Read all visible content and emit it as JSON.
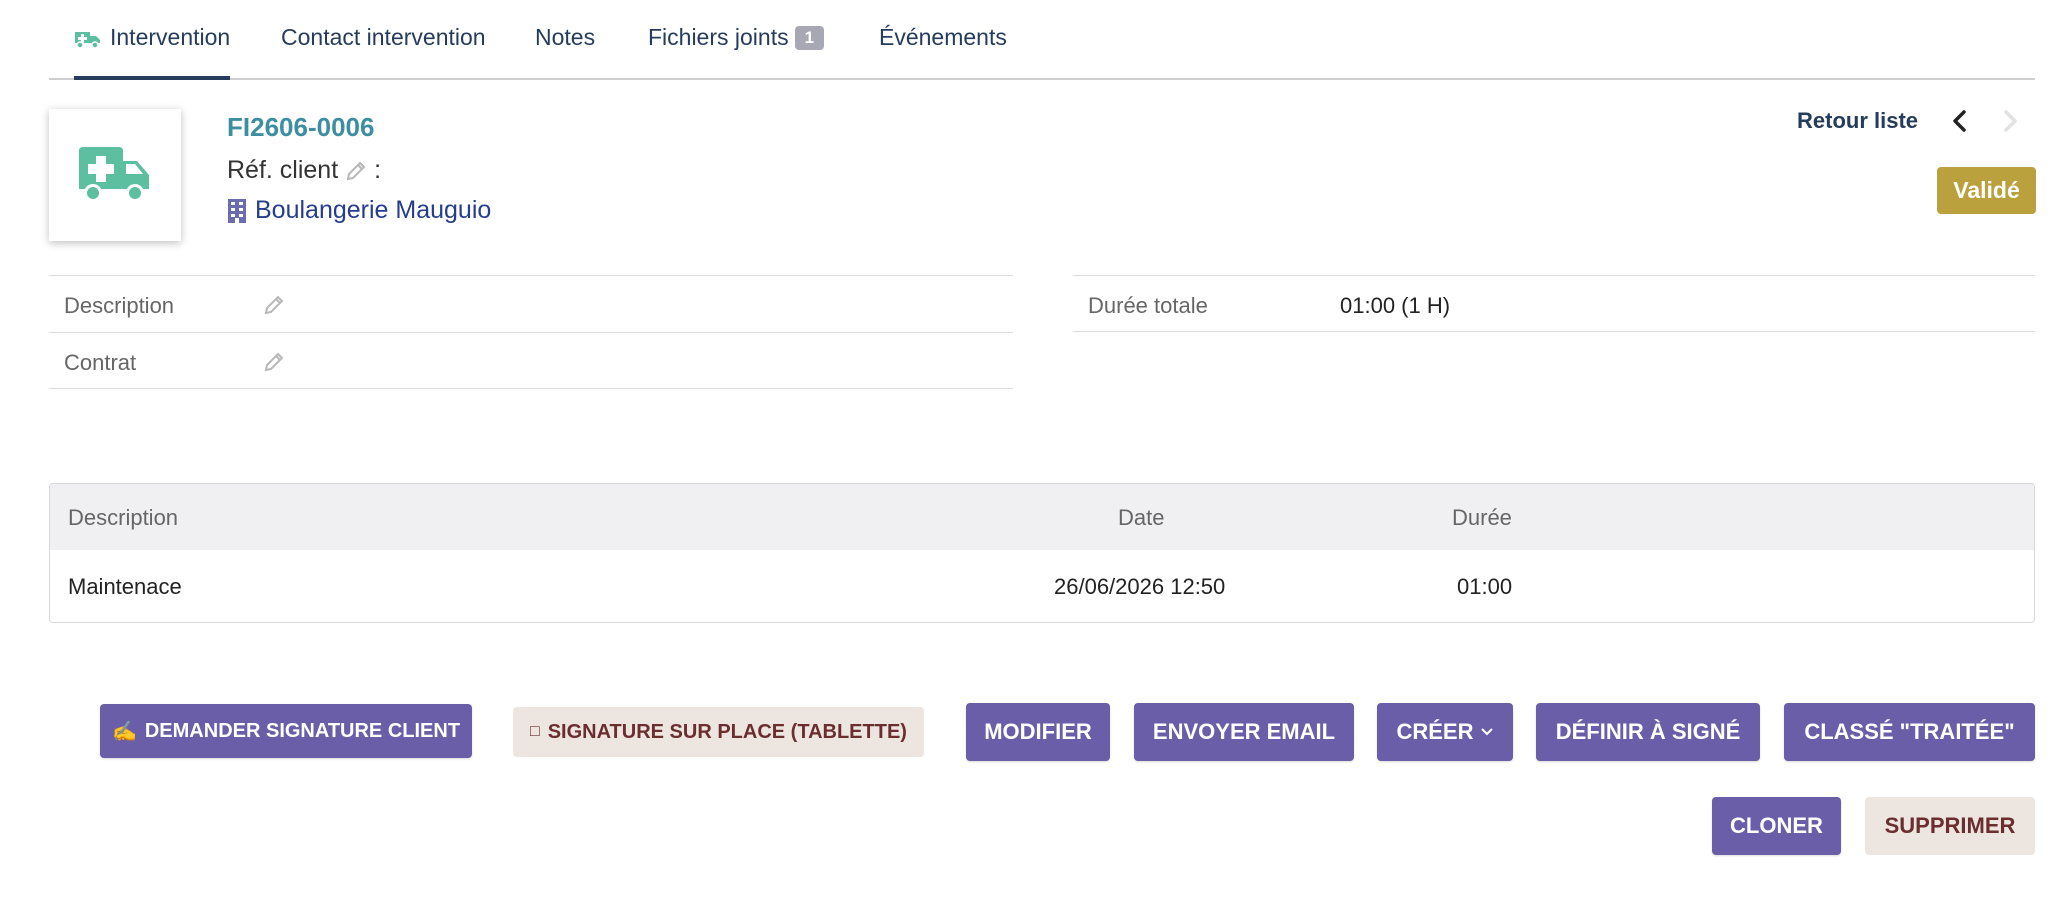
{
  "tabs": [
    {
      "label": "Intervention",
      "icon": "ambulance-icon",
      "active": true
    },
    {
      "label": "Contact intervention"
    },
    {
      "label": "Notes"
    },
    {
      "label": "Fichiers joints",
      "badge": "1"
    },
    {
      "label": "Événements"
    }
  ],
  "header": {
    "ref": "FI2606-0006",
    "ref_client_label": "Réf. client",
    "ref_client_suffix": ":",
    "company": "Boulangerie Mauguio",
    "back_label": "Retour liste",
    "status": "Validé",
    "logo_icon": "ambulance-icon"
  },
  "fields_left": [
    {
      "label": "Description",
      "value": ""
    },
    {
      "label": "Contrat",
      "value": ""
    }
  ],
  "fields_right": [
    {
      "label": "Durée totale",
      "value": "01:00 (1 H)"
    }
  ],
  "lines": {
    "headers": {
      "description": "Description",
      "date": "Date",
      "duration": "Durée"
    },
    "rows": [
      {
        "description": "Maintenace",
        "date": "26/06/2026 12:50",
        "duration": "01:00"
      }
    ]
  },
  "actions": {
    "request_signature": "DEMANDER SIGNATURE CLIENT",
    "request_signature_icon": "✍",
    "onsite_signature": "SIGNATURE SUR PLACE (TABLETTE)",
    "onsite_signature_icon": "□",
    "modify": "MODIFIER",
    "send_email": "ENVOYER EMAIL",
    "create": "CRÉER",
    "set_signed": "DÉFINIR À SIGNÉ",
    "classify_done": "CLASSÉ \"TRAITÉE\"",
    "clone": "CLONER",
    "delete": "SUPPRIMER"
  },
  "colors": {
    "primary_button": "#6b5ea8",
    "status_badge": "#bba13d",
    "link": "#263c8c",
    "ref": "#3d8ea0",
    "icon_green": "#5cbf9f"
  }
}
